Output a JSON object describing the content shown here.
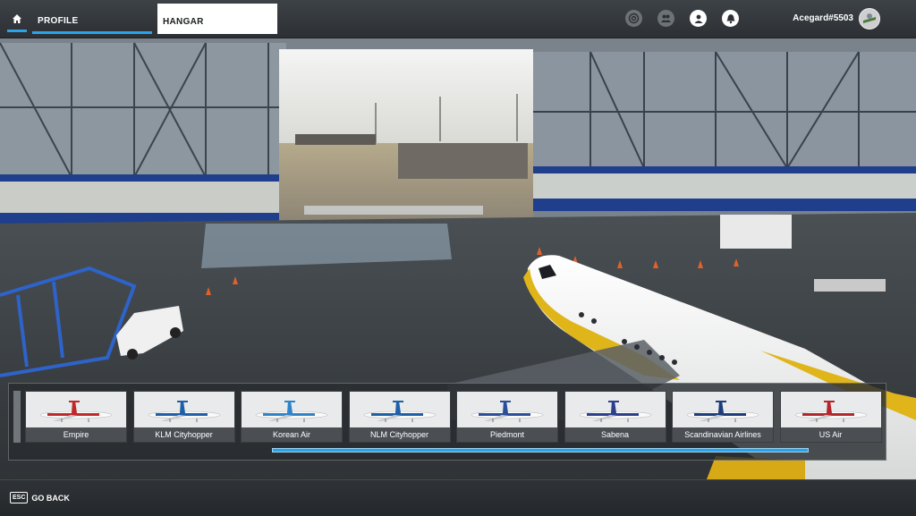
{
  "header": {
    "tabs": [
      {
        "label": "PROFILE",
        "active": false
      },
      {
        "label": "HANGAR",
        "active": true
      }
    ],
    "icons": [
      "home-icon",
      "activity-icon",
      "friends-icon",
      "profile-icon",
      "notifications-icon"
    ],
    "username": "Acegard#5503"
  },
  "livery_selector": {
    "items": [
      {
        "label": "Empire",
        "accent": "#c0282a"
      },
      {
        "label": "KLM Cityhopper",
        "accent": "#1f5fa8"
      },
      {
        "label": "Korean Air",
        "accent": "#2f84c9"
      },
      {
        "label": "NLM Cityhopper",
        "accent": "#1f5fa8"
      },
      {
        "label": "Piedmont",
        "accent": "#2a4f9a"
      },
      {
        "label": "Sabena",
        "accent": "#2b3f8c"
      },
      {
        "label": "Scandinavian Airlines",
        "accent": "#1e3d7b"
      },
      {
        "label": "US Air",
        "accent": "#b3262b"
      }
    ]
  },
  "footer": {
    "key": "ESC",
    "action_label": "GO BACK"
  },
  "colors": {
    "accent": "#2aa4e8",
    "aircraft_trim": "#e0b51a"
  }
}
